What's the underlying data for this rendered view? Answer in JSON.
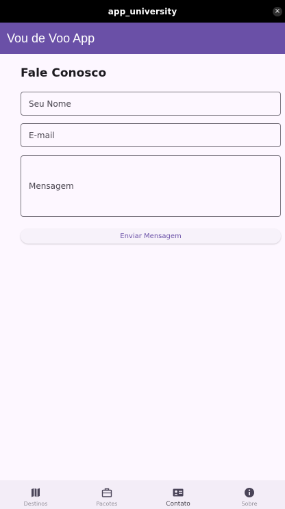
{
  "window": {
    "title": "app_university",
    "close_glyph": "×"
  },
  "appbar": {
    "title": "Vou de Voo App"
  },
  "page": {
    "title": "Fale Conosco"
  },
  "form": {
    "name_placeholder": "Seu Nome",
    "email_placeholder": "E-mail",
    "message_placeholder": "Mensagem",
    "send_label": "Enviar Mensagem"
  },
  "nav": {
    "active_index": 2,
    "items": [
      {
        "label": "Destinos",
        "icon": "map-icon"
      },
      {
        "label": "Pacotes",
        "icon": "briefcase-icon"
      },
      {
        "label": "Contato",
        "icon": "contact-card-icon"
      },
      {
        "label": "Sobre",
        "icon": "info-icon"
      }
    ]
  },
  "colors": {
    "appbar": "#6a50a7",
    "background": "#fdf7ff",
    "nav_background": "#f3edf7",
    "accent_text": "#6a50a7"
  }
}
